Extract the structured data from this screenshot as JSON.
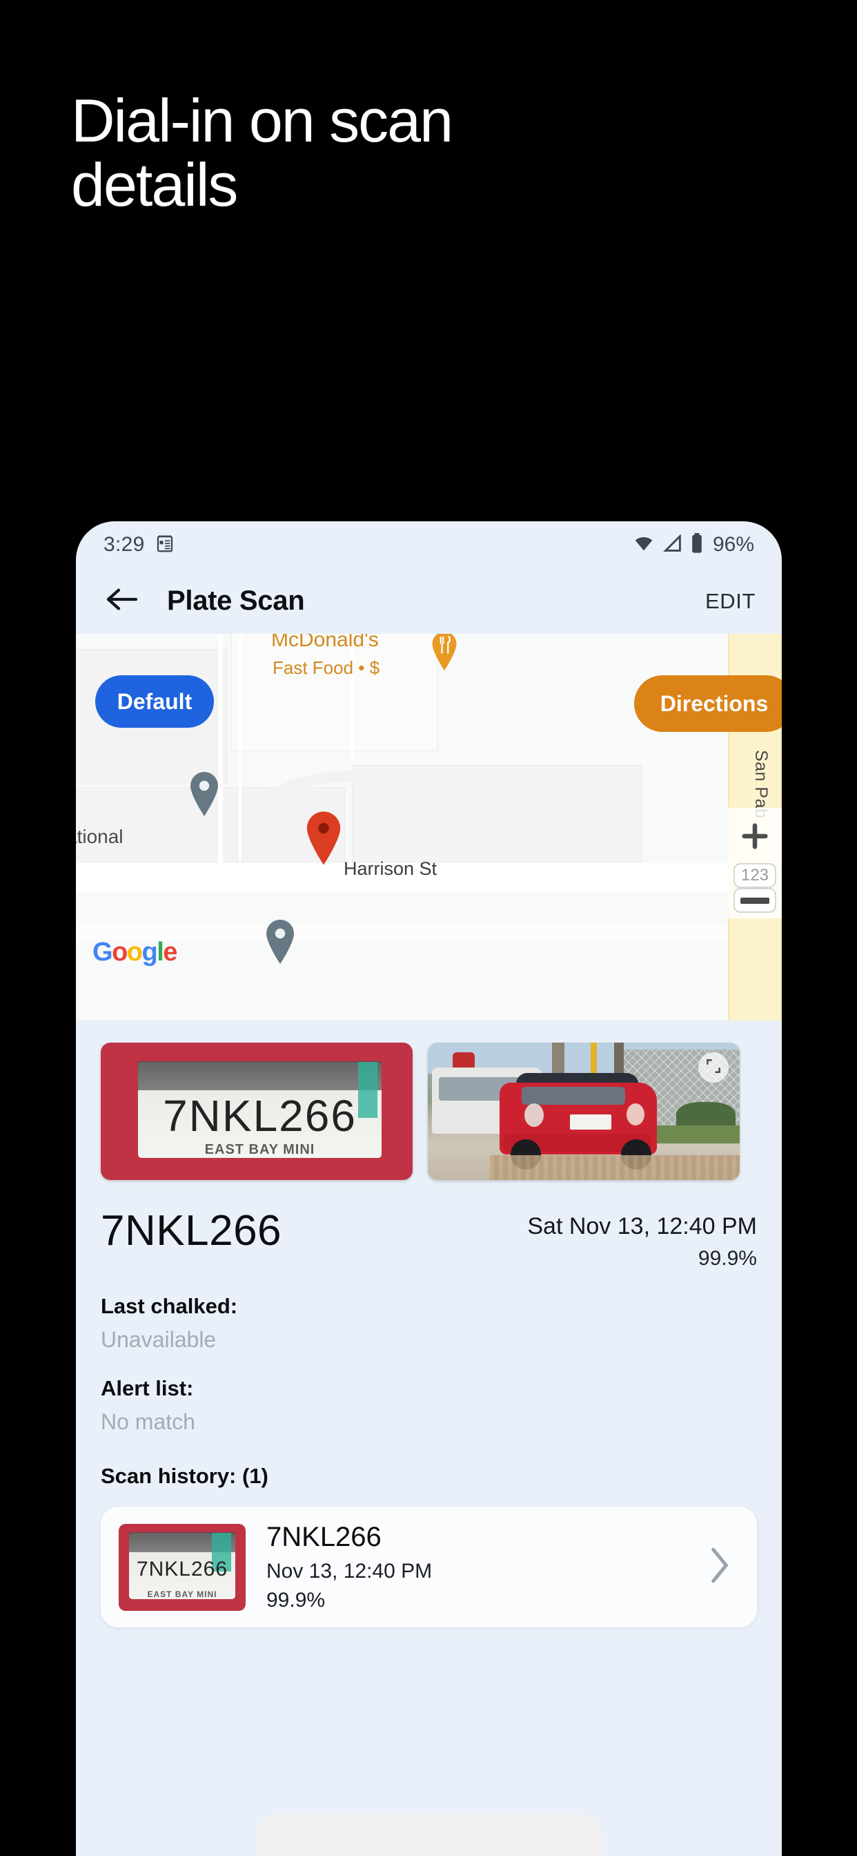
{
  "headline": "Dial-in on scan\ndetails",
  "statusbar": {
    "time": "3:29",
    "notes_icon": "notes-icon",
    "wifi_icon": "wifi-icon",
    "signal_icon": "cell-signal-icon",
    "battery_icon": "battery-icon",
    "battery_text": "96%"
  },
  "appbar": {
    "back_icon": "back-arrow-icon",
    "title": "Plate Scan",
    "edit_label": "EDIT"
  },
  "map": {
    "default_pill": "Default",
    "directions_pill": "Directions",
    "poi_name": "McDonald's",
    "poi_subtitle": "Fast Food • $",
    "street_vertical": "San Pab",
    "street_partial": "ational",
    "street_primary": "Harrison St",
    "attribution": "Google",
    "zoom_in_icon": "plus-icon",
    "zoom_out_icon": "minus-icon",
    "shield_label": "123",
    "default_pill_color": "#1f64de",
    "directions_pill_color": "#db8316",
    "pin_color": "#d93025"
  },
  "scan": {
    "plate_image_text": "7NKL266",
    "plate_frame_text": "EAST BAY MINI",
    "vehicle_image_name": "vehicle-photo",
    "expand_icon": "expand-icon",
    "plate_number": "7NKL266",
    "timestamp": "Sat Nov 13, 12:40 PM",
    "confidence": "99.9%"
  },
  "fields": [
    {
      "label": "Last chalked:",
      "value": "Unavailable"
    },
    {
      "label": "Alert list:",
      "value": "No match"
    }
  ],
  "history": {
    "section_title": "Scan history: (1)",
    "items": [
      {
        "thumb_plate_text": "7NKL266",
        "thumb_frame_text": "EAST BAY MINI",
        "plate": "7NKL266",
        "date": "Nov 13, 12:40 PM",
        "confidence": "99.9%",
        "chevron_icon": "chevron-right-icon"
      }
    ]
  }
}
